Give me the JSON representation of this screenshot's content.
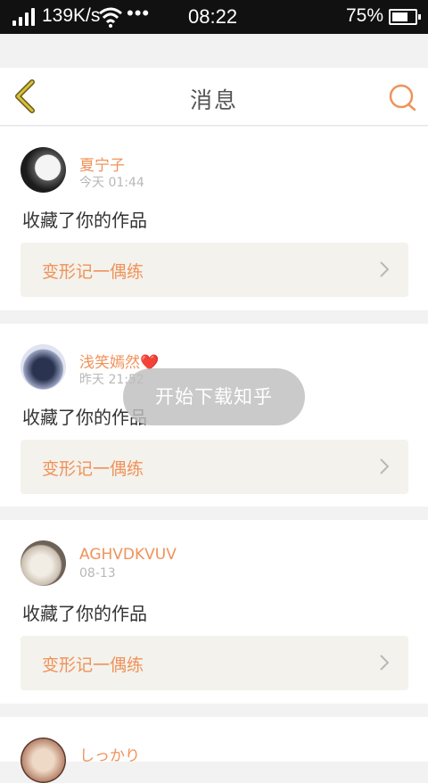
{
  "status_bar": {
    "speed": "139K/s",
    "more": "•••",
    "time": "08:22",
    "battery": "75%",
    "battery_level": 0.75
  },
  "header": {
    "title": "消息",
    "back_icon": "chevron-left-icon",
    "search_icon": "search-icon",
    "accent_color": "#f0925a",
    "back_color": "#d2b62e"
  },
  "messages": [
    {
      "user": "夏宁子",
      "time": "今天 01:44",
      "action": "收藏了你的作品",
      "work_title": "变形记一偶练"
    },
    {
      "user": "浅笑嫣然❤️",
      "time": "昨天 21:52",
      "action": "收藏了你的作品",
      "work_title": "变形记一偶练"
    },
    {
      "user": "AGHVDKVUV",
      "time": "08-13",
      "action": "收藏了你的作品",
      "work_title": "变形记一偶练"
    },
    {
      "user": "しっかり"
    }
  ],
  "toast": "开始下载知乎"
}
